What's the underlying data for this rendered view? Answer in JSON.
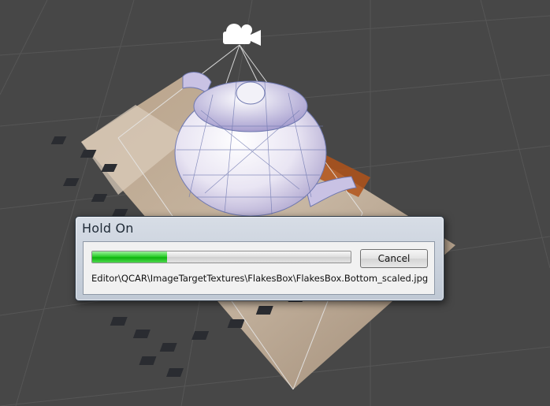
{
  "dialog": {
    "title": "Hold On",
    "progress_fraction": 0.29,
    "cancel_label": "Cancel",
    "status_path": "Editor\\QCAR\\ImageTargetTextures\\FlakesBox\\FlakesBox.Bottom_scaled.jpg"
  },
  "scene": {
    "background_color": "#474747",
    "grid_color": "#5a5a5a",
    "camera_gizmo_icon": "video-camera-icon",
    "teapot_color": "#ddd8ec",
    "wireframe_color": "#6f78b0"
  }
}
